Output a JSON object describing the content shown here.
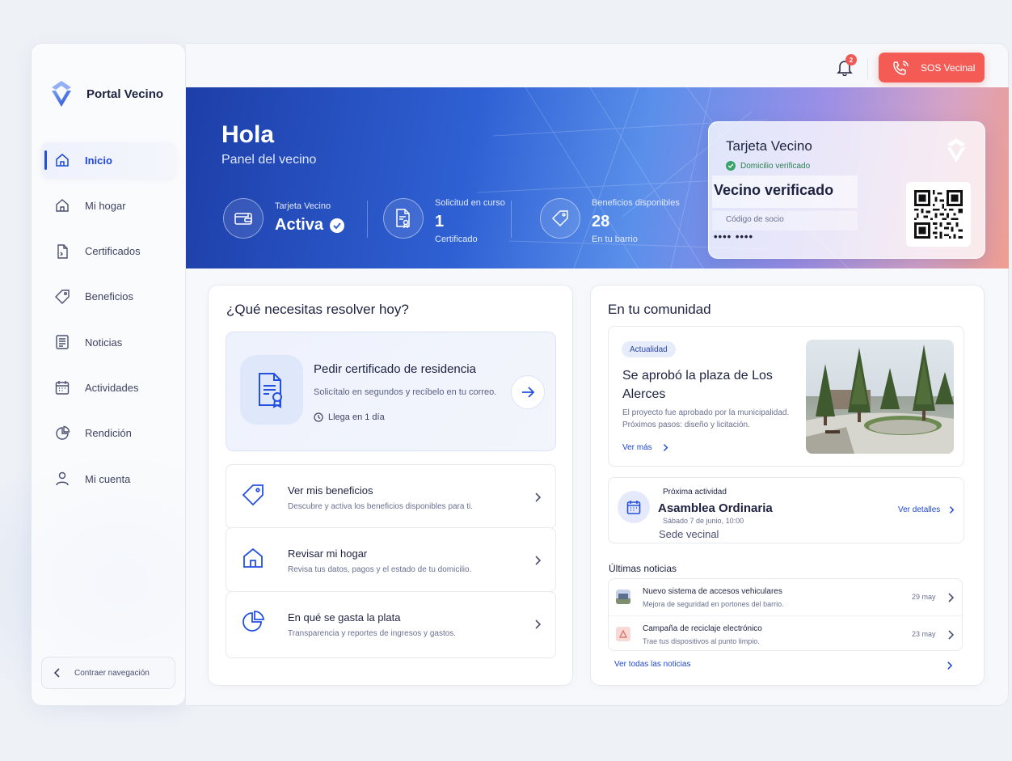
{
  "brand": {
    "name": "Portal Vecino"
  },
  "sidebar": {
    "items": [
      {
        "label": "Inicio",
        "icon": "home-icon"
      },
      {
        "label": "Mi hogar",
        "icon": "house-icon"
      },
      {
        "label": "Certificados",
        "icon": "document-icon"
      },
      {
        "label": "Beneficios",
        "icon": "tag-icon"
      },
      {
        "label": "Noticias",
        "icon": "newspaper-icon"
      },
      {
        "label": "Actividades",
        "icon": "calendar-icon"
      },
      {
        "label": "Rendición",
        "icon": "pie-chart-icon"
      },
      {
        "label": "Mi cuenta",
        "icon": "user-icon"
      }
    ],
    "collapse_label": "Contraer navegación"
  },
  "topbar": {
    "notifications_count": "2",
    "sos_label": "SOS Vecinal"
  },
  "hero": {
    "title": "Hola",
    "subtitle": "Panel del vecino",
    "stats": [
      {
        "label": "Tarjeta Vecino",
        "value": "Activa",
        "note": ""
      },
      {
        "label": "Solicitud en curso",
        "value": "1",
        "note": "Certificado"
      },
      {
        "label": "Beneficios disponibles",
        "value": "28",
        "note": "En tu barrio"
      }
    ]
  },
  "vecino_card": {
    "title": "Tarjeta Vecino",
    "verified_label": "Domicilio verificado",
    "name": "Vecino verificado",
    "code_label": "Código de socio",
    "code": "•••• ••••"
  },
  "resolve": {
    "title": "¿Qué necesitas resolver hoy?",
    "featured": {
      "title": "Pedir certificado de residencia",
      "description": "Solicítalo en segundos y recíbelo en tu correo.",
      "time": "Llega en 1 día"
    },
    "actions": [
      {
        "title": "Ver mis beneficios",
        "description": "Descubre y activa los beneficios disponibles para ti."
      },
      {
        "title": "Revisar mi hogar",
        "description": "Revisa tus datos, pagos y el estado de tu domicilio."
      },
      {
        "title": "En qué se gasta la plata",
        "description": "Transparencia y reportes de ingresos y gastos."
      }
    ]
  },
  "community": {
    "title": "En tu comunidad",
    "news_card": {
      "tag": "Actualidad",
      "title": "Se aprobó la plaza de Los Alerces",
      "description": "El proyecto fue aprobado por la municipalidad. Próximos pasos: diseño y licitación.",
      "more_label": "Ver más"
    },
    "event": {
      "label": "Próxima actividad",
      "title": "Asamblea Ordinaria",
      "date": "Sábado 7 de junio, 10:00",
      "place": "Sede vecinal",
      "link": "Ver detalles"
    },
    "latest_title": "Últimas noticias",
    "latest": [
      {
        "title": "Nuevo sistema de accesos vehiculares",
        "description": "Mejora de seguridad en portones del barrio.",
        "date": "29 may"
      },
      {
        "title": "Campaña de reciclaje electrónico",
        "description": "Trae tus dispositivos al punto limpio.",
        "date": "23 may"
      }
    ],
    "all_news": "Ver todas las noticias"
  },
  "colors": {
    "accent": "#1f47d4",
    "sos": "#f45b55",
    "verified": "#2a7e4f"
  }
}
